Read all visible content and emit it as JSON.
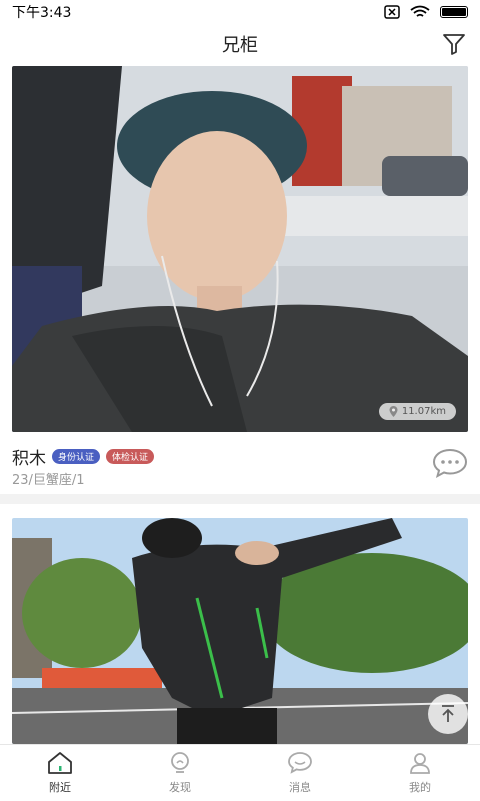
{
  "status_bar": {
    "time": "下午3:43"
  },
  "header": {
    "title": "兄柜"
  },
  "cards": [
    {
      "name": "积木",
      "badges": [
        "身份认证",
        "体检认证"
      ],
      "meta": "23/巨蟹座/1",
      "distance": "11.07km"
    }
  ],
  "bottom_nav": [
    {
      "label": "附近",
      "active": true
    },
    {
      "label": "发现",
      "active": false
    },
    {
      "label": "消息",
      "active": false
    },
    {
      "label": "我的",
      "active": false
    }
  ],
  "colors": {
    "badge_id": "#4a5fc1",
    "badge_health": "#c85a5a"
  }
}
